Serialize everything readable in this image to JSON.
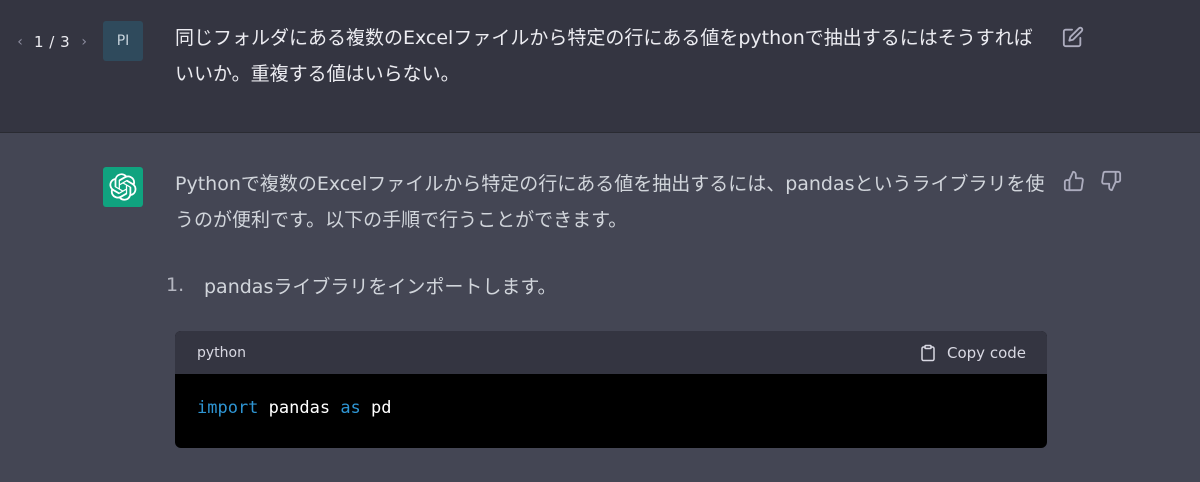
{
  "user_message": {
    "pager": {
      "prev_icon": "chevron-left-icon",
      "label": "1 / 3",
      "next_icon": "chevron-right-icon"
    },
    "avatar_initials": "PI",
    "text": "同じフォルダにある複数のExcelファイルから特定の行にある値をpythonで抽出するにはそうすればいいか。重複する値はいらない。",
    "edit_icon": "edit-icon"
  },
  "assistant_message": {
    "avatar_icon": "openai-logo-icon",
    "intro": "Pythonで複数のExcelファイルから特定の行にある値を抽出するには、pandasというライブラリを使うのが便利です。以下の手順で行うことができます。",
    "feedback": {
      "up_icon": "thumbs-up-icon",
      "down_icon": "thumbs-down-icon"
    },
    "steps": [
      {
        "number": "1.",
        "text": "pandasライブラリをインポートします。"
      }
    ],
    "code_block": {
      "language": "python",
      "copy_label": "Copy code",
      "line": {
        "kw1": "import",
        "mod": " pandas ",
        "kw2": "as",
        "alias": " pd"
      }
    }
  },
  "colors": {
    "user_bg": "#343541",
    "assistant_bg": "#444654",
    "gpt_avatar": "#10a37f",
    "keyword": "#2e95d3"
  }
}
